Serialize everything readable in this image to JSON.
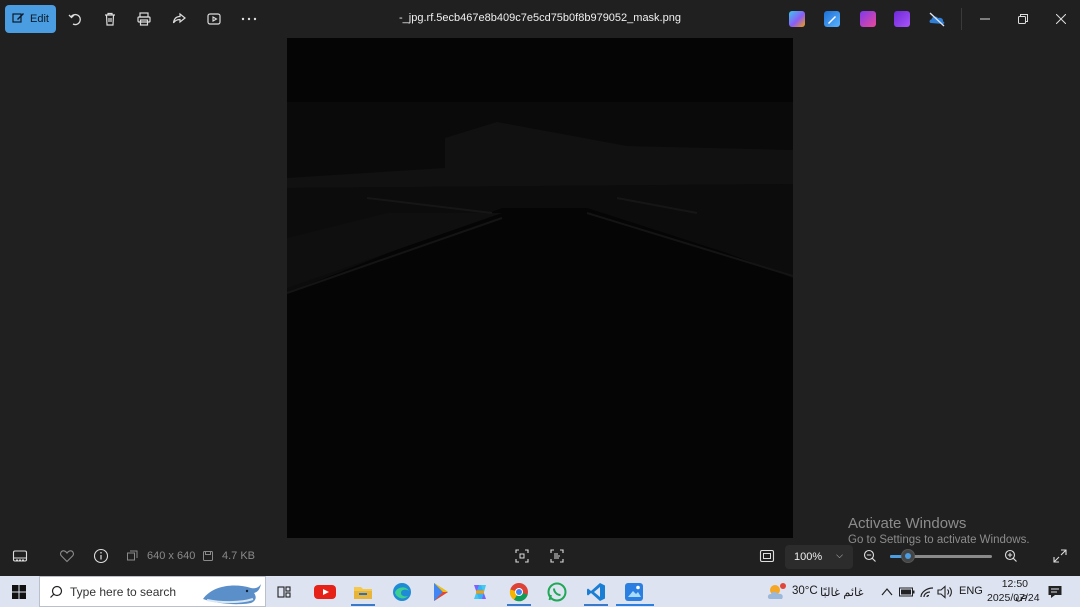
{
  "toolbar": {
    "edit_label": "Edit",
    "icons": [
      "rotate-icon",
      "delete-icon",
      "print-icon",
      "share-icon",
      "slideshow-icon",
      "more-icon"
    ]
  },
  "window": {
    "title": "-_jpg.rf.5ecb467e8b409c7e5cd75b0f8b979052_mask.png",
    "apps": [
      "copilot-icon",
      "photo-editor-icon",
      "clipchamp-icon",
      "video-editor-icon",
      "onedrive-icon"
    ]
  },
  "info": {
    "dimensions": "640 x 640",
    "file_size": "4.7 KB"
  },
  "zoom": {
    "level_label": "100%",
    "slider_fraction": 0.18
  },
  "watermark": {
    "line1": "Activate Windows",
    "line2": "Go to Settings to activate Windows."
  },
  "taskbar": {
    "search_placeholder": "Type here to search",
    "apps": [
      "task-view-icon",
      "youtube-icon",
      "file-explorer-icon",
      "edge-icon",
      "play-store-icon",
      "copilot-icon",
      "chrome-icon",
      "whatsapp-icon",
      "vscode-icon",
      "photos-icon"
    ],
    "weather_temp": "30°C",
    "weather_desc": "غائم غالبًا",
    "language": "ENG",
    "time": "12:50 ص",
    "date": "2025/07/24"
  }
}
